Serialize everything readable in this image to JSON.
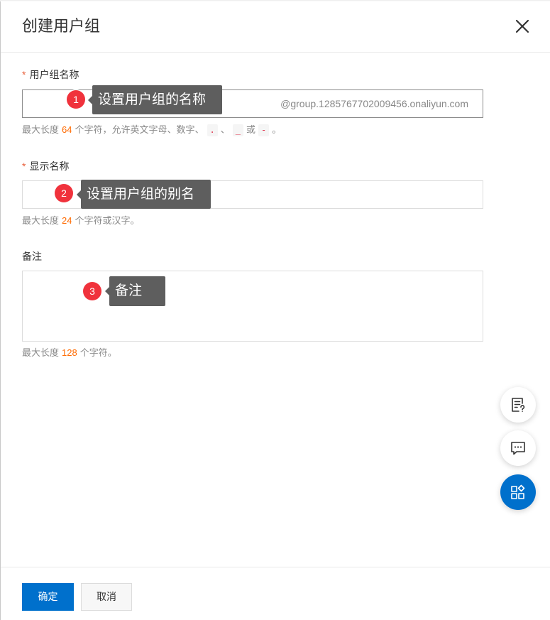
{
  "dialog": {
    "title": "创建用户组",
    "close_icon": "close-icon"
  },
  "form": {
    "group_name": {
      "required": "*",
      "label": "用户组名称",
      "value": "",
      "suffix": "@group.1285767702009456.onaliyun.com",
      "help": {
        "text_before": "最大长度",
        "limit": "64",
        "text_after": "个字符，允许英文字母、数字、",
        "token_dot": ".",
        "sep": "、",
        "token_underscore": "_",
        "text_or": "或",
        "token_dash": "-",
        "text_end": "。"
      }
    },
    "display_name": {
      "required": "*",
      "label": "显示名称",
      "value": "",
      "help": {
        "text_before": "最大长度",
        "limit": "24",
        "text_after": "个字符或汉字。"
      }
    },
    "remark": {
      "label": "备注",
      "value": "",
      "help": {
        "text_before": "最大长度",
        "limit": "128",
        "text_after": "个字符。"
      }
    }
  },
  "annotations": [
    {
      "number": "1",
      "text": "设置用户组的名称"
    },
    {
      "number": "2",
      "text": "设置用户组的别名"
    },
    {
      "number": "3",
      "text": "备注"
    }
  ],
  "floating_actions": [
    {
      "icon": "doc-question-icon"
    },
    {
      "icon": "chat-icon"
    },
    {
      "icon": "apps-icon"
    }
  ],
  "footer": {
    "confirm_label": "确定",
    "cancel_label": "取消"
  },
  "colors": {
    "primary": "#0070cc",
    "accent_number": "#ff6a00",
    "required_mark": "#e8603c",
    "annotation_badge": "#f0323c",
    "annotation_tooltip": "#5e5e5e"
  }
}
